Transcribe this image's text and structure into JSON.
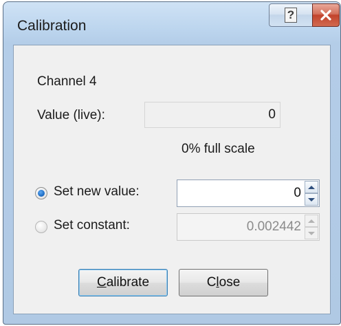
{
  "window": {
    "title": "Calibration",
    "help_glyph": "?",
    "close_glyph": "x"
  },
  "channel_label": "Channel 4",
  "live_value": {
    "label": "Value (live):",
    "value": "0",
    "full_scale_text": "0% full scale"
  },
  "options": {
    "set_new_value": {
      "label": "Set new value:",
      "selected": true,
      "value": "0"
    },
    "set_constant": {
      "label": "Set constant:",
      "selected": false,
      "value": "0.002442",
      "enabled": false
    }
  },
  "buttons": {
    "calibrate": {
      "mnemonic": "C",
      "rest": "alibrate"
    },
    "close": {
      "pre": "C",
      "mnemonic": "l",
      "rest": "ose"
    }
  },
  "colors": {
    "frame_top": "#cfe2f5",
    "frame_bottom": "#b0c9e4",
    "close_button_red": "#c2432c",
    "client_background": "#f0f0f0",
    "radio_selected": "#1f6fc7"
  },
  "icons": {
    "help": "question-mark-icon",
    "close": "x-icon",
    "spin_up": "triangle-up-icon",
    "spin_down": "triangle-down-icon"
  }
}
